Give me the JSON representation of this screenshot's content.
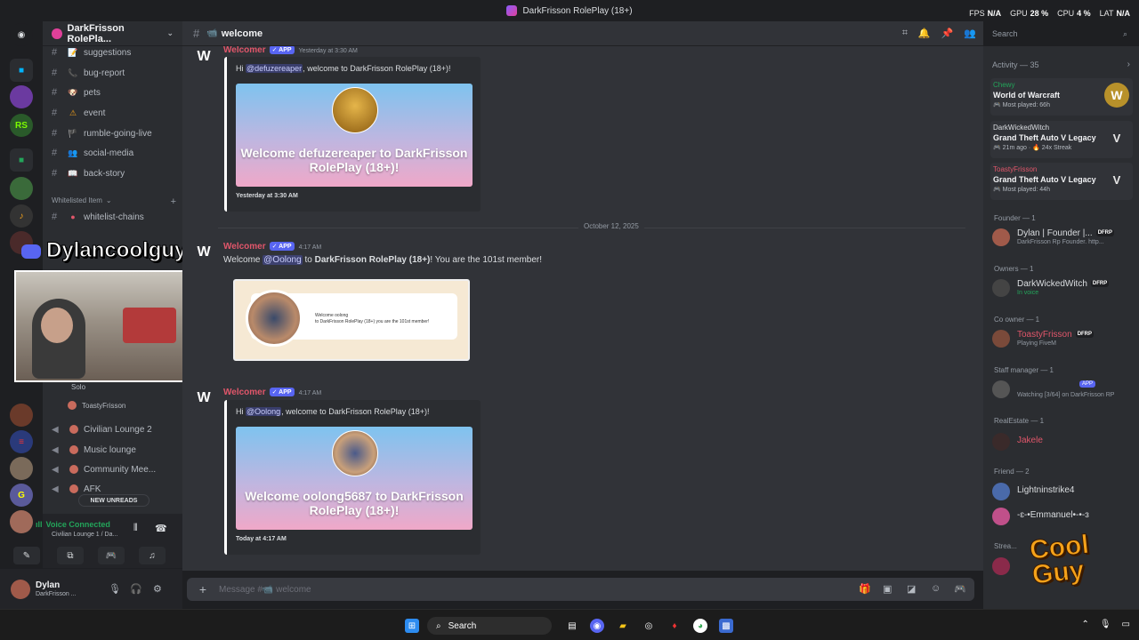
{
  "window": {
    "title": "DarkFrisson RolePlay (18+)"
  },
  "hud": {
    "fps_label": "FPS",
    "fps": "N/A",
    "gpu_label": "GPU",
    "gpu": "28 %",
    "cpu_label": "CPU",
    "cpu": "4 %",
    "lat_label": "LAT",
    "lat": "N/A"
  },
  "server": {
    "name": "DarkFrisson RolePla..."
  },
  "channels": [
    {
      "name": "suggestions",
      "emoji": "📝"
    },
    {
      "name": "bug-report",
      "emoji": "📞"
    },
    {
      "name": "pets",
      "emoji": "🐶"
    },
    {
      "name": "event",
      "emoji": "⚠"
    },
    {
      "name": "rumble-going-live",
      "emoji": "🏴"
    },
    {
      "name": "social-media",
      "emoji": "👥"
    },
    {
      "name": "back-story",
      "emoji": "📖"
    }
  ],
  "category": {
    "name": "Whitelisted Item"
  },
  "whitelist_channel": {
    "name": "whitelist-chains"
  },
  "voice_channels": {
    "solo": "Solo",
    "toasty": "ToastyFrisson",
    "list": [
      "Civilian Lounge 2",
      "Music lounge",
      "Community Mee...",
      "AFK"
    ]
  },
  "new_unreads": "NEW UNREADS",
  "overlay": {
    "streamer": "Dylancoolguy"
  },
  "voice_panel": {
    "status": "Voice Connected",
    "channel": "Civilian Lounge 1 / Da..."
  },
  "user_panel": {
    "name": "Dylan",
    "sub": "DarkFrisson ..."
  },
  "chat": {
    "channel": "welcome",
    "composer_placeholder": "Message #📹 welcome",
    "date_divider": "October 12, 2025",
    "messages": [
      {
        "author": "Welcomer",
        "tag": "✓ APP",
        "time": "Yesterday at 3:30 AM",
        "greet_pre": "Hi ",
        "mention": "@defuzereaper",
        "greet_post": ", welcome to DarkFrisson RolePlay (18+)!",
        "banner": "Welcome defuzereaper to DarkFrisson RolePlay (18+)!",
        "footer": "Yesterday at 3:30 AM"
      },
      {
        "author": "Welcomer",
        "tag": "✓ APP",
        "time": "4:17 AM",
        "text_pre": "Welcome ",
        "mention": "@Oolong",
        "text_mid": " to ",
        "text_bold": "DarkFrisson RolePlay (18+)",
        "text_post": "! You are the 101st member!",
        "card_line1": "Welcome oolong",
        "card_line2": "to DarkFrisson RolePlay (18+) you are the 101st member!"
      },
      {
        "author": "Welcomer",
        "tag": "✓ APP",
        "time": "4:17 AM",
        "greet_pre": "Hi ",
        "mention": "@Oolong",
        "greet_post": ", welcome to DarkFrisson RolePlay (18+)!",
        "banner": "Welcome oolong5687 to DarkFrisson RolePlay (18+)!",
        "footer": "Today at 4:17 AM"
      }
    ]
  },
  "search": {
    "placeholder": "Search"
  },
  "members": {
    "activity_title": "Activity — 35",
    "activities": [
      {
        "who": "Chewy",
        "game": "World of Warcraft",
        "detail": "🎮 Most played: 66h",
        "icon": "W"
      },
      {
        "who": "DarkWickedWitch",
        "game": "Grand Theft Auto V Legacy",
        "detail": "🎮 21m ago · 🔥 24x Streak",
        "icon": "V"
      },
      {
        "who": "ToastyFrisson",
        "game": "Grand Theft Auto V Legacy",
        "detail": "🎮 Most played: 44h",
        "icon": "V"
      }
    ],
    "groups": [
      {
        "role": "Founder — 1",
        "name": "Dylan | Founder |...",
        "tag": "DFRP",
        "sub": "DarkFrisson Rp Founder. http..."
      },
      {
        "role": "Owners — 1",
        "name": "DarkWickedWitch",
        "tag": "DFRP",
        "sub": "In voice"
      },
      {
        "role": "Co owner — 1",
        "name": "ToastyFrisson",
        "tag": "DFRP",
        "sub": "Playing FiveM"
      },
      {
        "role": "Staff manager — 1",
        "name": "",
        "tag": "APP",
        "sub": "Watching [3/64] on DarkFrisson RP"
      },
      {
        "role": "RealEstate — 1",
        "name": "Jakele",
        "tag": "",
        "sub": ""
      },
      {
        "role": "Friend — 2",
        "name": "Lightninstrike4",
        "tag": "",
        "sub": ""
      },
      {
        "role": "",
        "name": "-ɛ-•Emmanuel•-•-ɜ",
        "tag": "",
        "sub": ""
      },
      {
        "role": "Strea...",
        "name": "",
        "tag": "",
        "sub": ""
      }
    ]
  },
  "watermark": {
    "line1": "Cool",
    "line2": "Guy"
  },
  "taskbar": {
    "search": "Search"
  },
  "colors": {
    "accent": "#5865f2",
    "online": "#23a55a",
    "welcomer": "#e0566a",
    "bg_chat": "#313338"
  }
}
